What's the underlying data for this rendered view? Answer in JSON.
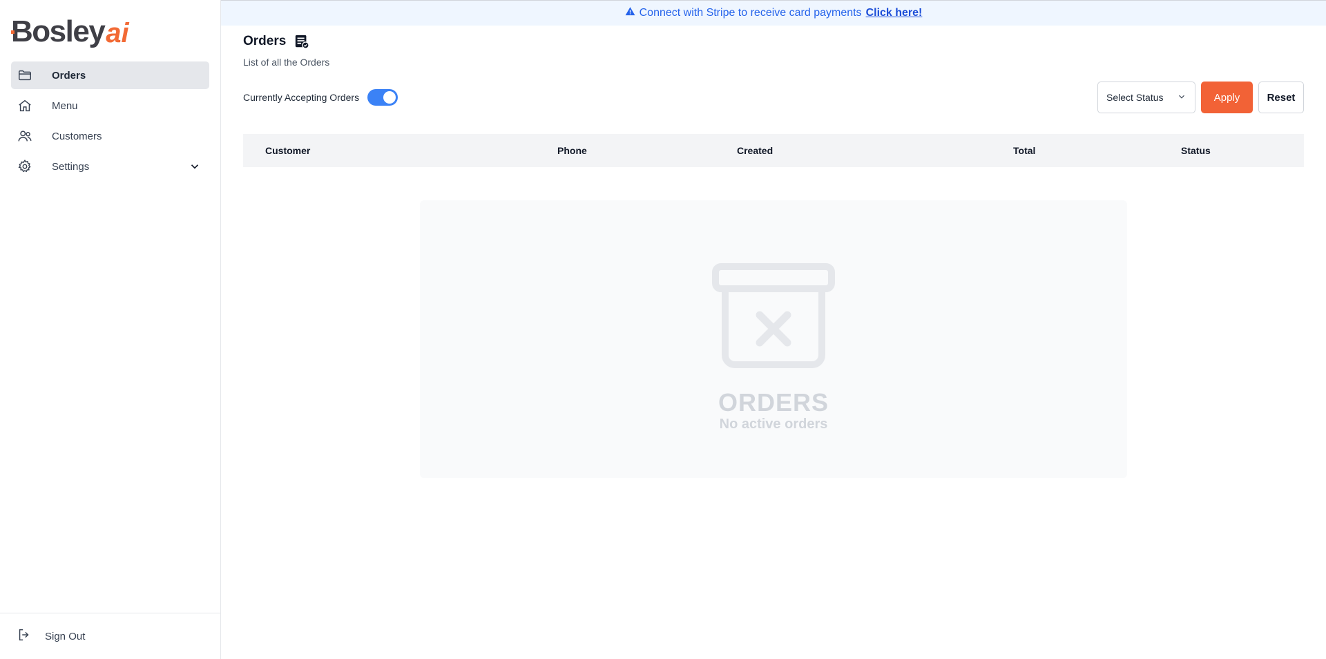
{
  "brand": {
    "name": "Bosley",
    "suffix": "ai",
    "accent": "#f26236"
  },
  "sidebar": {
    "items": [
      {
        "label": "Orders",
        "icon": "folder-icon",
        "active": true
      },
      {
        "label": "Menu",
        "icon": "home-icon"
      },
      {
        "label": "Customers",
        "icon": "users-icon"
      },
      {
        "label": "Settings",
        "icon": "gear-icon",
        "expandable": true
      }
    ],
    "signout_label": "Sign Out"
  },
  "banner": {
    "text": "Connect with Stripe to receive card payments",
    "link_text": "Click here!"
  },
  "page": {
    "title": "Orders",
    "subtitle": "List of all the Orders",
    "accepting_label": "Currently Accepting Orders",
    "accepting_enabled": true
  },
  "filters": {
    "status_placeholder": "Select Status",
    "apply_label": "Apply",
    "reset_label": "Reset"
  },
  "table": {
    "columns": [
      "Customer",
      "Phone",
      "Created",
      "Total",
      "Status"
    ]
  },
  "empty_state": {
    "title": "ORDERS",
    "subtitle": "No active orders"
  }
}
